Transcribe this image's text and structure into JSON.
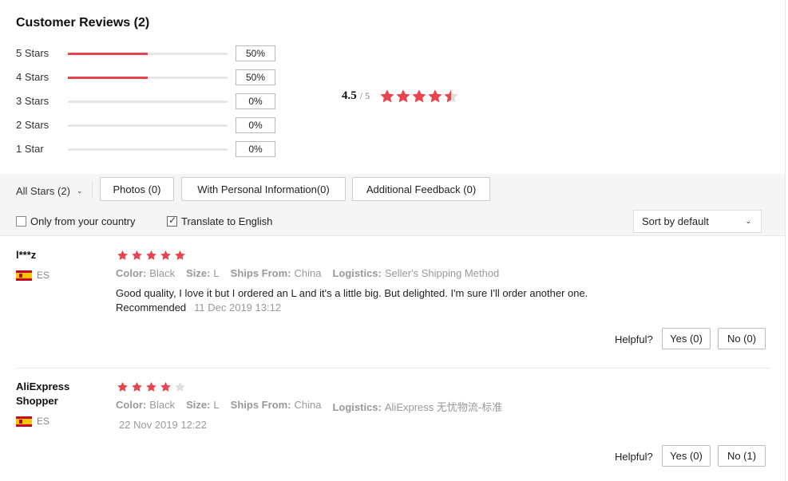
{
  "summary": {
    "title": "Customer Reviews (2)",
    "average": "4.5",
    "out_of": "/ 5",
    "average_value": 4.5,
    "star_color": "#e8444d",
    "empty_star_color": "#dddddd",
    "distribution": [
      {
        "label": "5 Stars",
        "percent_text": "50%",
        "percent": 50
      },
      {
        "label": "4 Stars",
        "percent_text": "50%",
        "percent": 50
      },
      {
        "label": "3 Stars",
        "percent_text": "0%",
        "percent": 0
      },
      {
        "label": "2 Stars",
        "percent_text": "0%",
        "percent": 0
      },
      {
        "label": "1 Star",
        "percent_text": "0%",
        "percent": 0
      }
    ]
  },
  "filters": {
    "all_stars": "All Stars (2)",
    "photos": "Photos (0)",
    "personal_info": "With Personal Information(0)",
    "additional_feedback": "Additional Feedback (0)"
  },
  "options": {
    "only_country": {
      "label": "Only from your country",
      "checked": false
    },
    "translate": {
      "label": "Translate to English",
      "checked": true
    },
    "sort": "Sort by default"
  },
  "reviews": [
    {
      "name": "l***z",
      "country": "ES",
      "rating": 5,
      "color_label": "Color:",
      "color": "Black",
      "size_label": "Size:",
      "size": "L",
      "ships_label": "Ships From:",
      "ships": "China",
      "logistics_label": "Logistics:",
      "logistics": "Seller's Shipping Method",
      "text": "Good quality, I love it but I ordered an L and it's a little big. But delighted. I'm sure I'll order another one.",
      "recommend": "Recommended",
      "date": "11 Dec 2019 13:12",
      "helpful": "Helpful?",
      "yes": "Yes (0)",
      "no": "No (0)"
    },
    {
      "name": "AliExpress Shopper",
      "country": "ES",
      "rating": 4,
      "color_label": "Color:",
      "color": "Black",
      "size_label": "Size:",
      "size": "L",
      "ships_label": "Ships From:",
      "ships": "China",
      "logistics_label": "Logistics:",
      "logistics": "AliExpress 无忧物流-标准",
      "text": "",
      "recommend": "",
      "date": "22 Nov 2019 12:22",
      "helpful": "Helpful?",
      "yes": "Yes (0)",
      "no": "No (1)"
    }
  ]
}
